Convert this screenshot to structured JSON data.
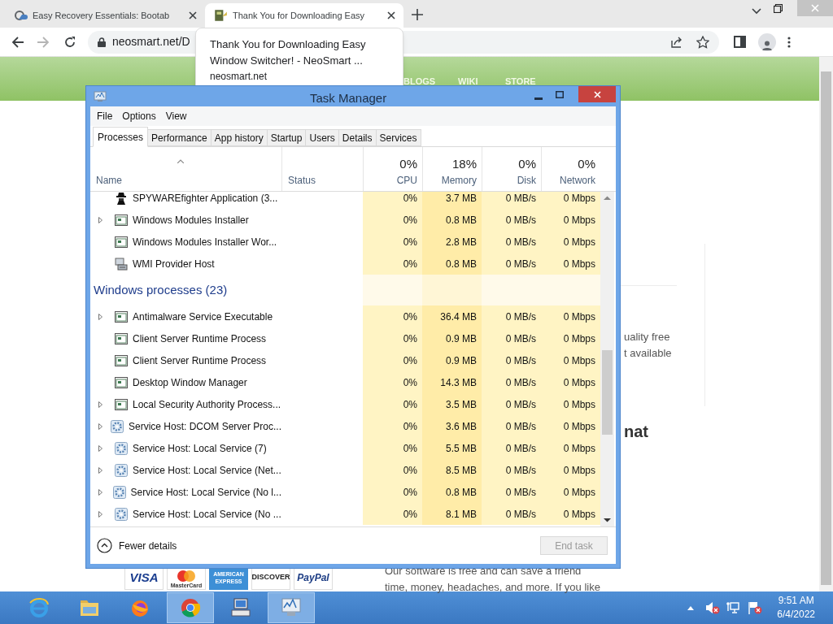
{
  "browser": {
    "tabs": [
      {
        "title": "Easy Recovery Essentials: Bootab",
        "selected": false
      },
      {
        "title": "Thank You for Downloading Easy",
        "selected": true
      }
    ],
    "address": "neosmart.net/D",
    "tooltip": {
      "title": "Thank You for Downloading Easy Window Switcher! - NeoSmart ...",
      "domain": "neosmart.net"
    }
  },
  "site": {
    "nav": [
      "BLOGS",
      "WIKI",
      "STORE"
    ],
    "fragments": [
      "uality free",
      "t available"
    ],
    "heading": "nat",
    "paragraph": [
      "Our software is free and can save a friend",
      "time, money, headaches, and more. If you like"
    ],
    "payment_logos": [
      {
        "kind": "visa",
        "text": "VISA"
      },
      {
        "kind": "mastercard",
        "text": "MasterCard"
      },
      {
        "kind": "amex",
        "text": "AMERICAN EXPRESS"
      },
      {
        "kind": "discover",
        "text": "DISCOVER"
      },
      {
        "kind": "paypal",
        "text": "PayPal"
      }
    ]
  },
  "task_manager": {
    "title": "Task Manager",
    "menu": [
      "File",
      "Options",
      "View"
    ],
    "tabs": [
      {
        "label": "Processes",
        "selected": true
      },
      {
        "label": "Performance",
        "selected": false
      },
      {
        "label": "App history",
        "selected": false
      },
      {
        "label": "Startup",
        "selected": false
      },
      {
        "label": "Users",
        "selected": false
      },
      {
        "label": "Details",
        "selected": false
      },
      {
        "label": "Services",
        "selected": false
      }
    ],
    "columns": [
      {
        "label": "Name"
      },
      {
        "label": "Status"
      },
      {
        "label": "CPU",
        "percent": "0%"
      },
      {
        "label": "Memory",
        "percent": "18%"
      },
      {
        "label": "Disk",
        "percent": "0%"
      },
      {
        "label": "Network",
        "percent": "0%"
      }
    ],
    "rows": [
      {
        "kind": "figure",
        "name": "SPYWAREfighter Application (3...",
        "expandable": false,
        "cpu": "0%",
        "memory": "3.7 MB",
        "disk": "0 MB/s",
        "network": "0 Mbps"
      },
      {
        "kind": "app",
        "name": "Windows Modules Installer",
        "expandable": true,
        "cpu": "0%",
        "memory": "0.8 MB",
        "disk": "0 MB/s",
        "network": "0 Mbps"
      },
      {
        "kind": "app",
        "name": "Windows Modules Installer Wor...",
        "expandable": false,
        "cpu": "0%",
        "memory": "2.8 MB",
        "disk": "0 MB/s",
        "network": "0 Mbps"
      },
      {
        "kind": "machine",
        "name": "WMI Provider Host",
        "expandable": false,
        "cpu": "0%",
        "memory": "0.8 MB",
        "disk": "0 MB/s",
        "network": "0 Mbps"
      },
      {
        "kind": "group",
        "name": "Windows processes (23)"
      },
      {
        "kind": "app",
        "name": "Antimalware Service Executable",
        "expandable": true,
        "cpu": "0%",
        "memory": "36.4 MB",
        "disk": "0 MB/s",
        "network": "0 Mbps"
      },
      {
        "kind": "app",
        "name": "Client Server Runtime Process",
        "expandable": false,
        "cpu": "0%",
        "memory": "0.9 MB",
        "disk": "0 MB/s",
        "network": "0 Mbps"
      },
      {
        "kind": "app",
        "name": "Client Server Runtime Process",
        "expandable": false,
        "cpu": "0%",
        "memory": "0.9 MB",
        "disk": "0 MB/s",
        "network": "0 Mbps"
      },
      {
        "kind": "app",
        "name": "Desktop Window Manager",
        "expandable": false,
        "cpu": "0%",
        "memory": "14.3 MB",
        "disk": "0 MB/s",
        "network": "0 Mbps"
      },
      {
        "kind": "app",
        "name": "Local Security Authority Process...",
        "expandable": true,
        "cpu": "0%",
        "memory": "3.5 MB",
        "disk": "0 MB/s",
        "network": "0 Mbps"
      },
      {
        "kind": "gear",
        "name": "Service Host: DCOM Server Proc...",
        "expandable": true,
        "cpu": "0%",
        "memory": "3.6 MB",
        "disk": "0 MB/s",
        "network": "0 Mbps"
      },
      {
        "kind": "gear",
        "name": "Service Host: Local Service (7)",
        "expandable": true,
        "cpu": "0%",
        "memory": "5.5 MB",
        "disk": "0 MB/s",
        "network": "0 Mbps"
      },
      {
        "kind": "gear",
        "name": "Service Host: Local Service (Net...",
        "expandable": true,
        "cpu": "0%",
        "memory": "8.5 MB",
        "disk": "0 MB/s",
        "network": "0 Mbps"
      },
      {
        "kind": "gear",
        "name": "Service Host: Local Service (No l...",
        "expandable": true,
        "cpu": "0%",
        "memory": "0.8 MB",
        "disk": "0 MB/s",
        "network": "0 Mbps"
      },
      {
        "kind": "gear",
        "name": "Service Host: Local Service (No ...",
        "expandable": true,
        "cpu": "0%",
        "memory": "8.1 MB",
        "disk": "0 MB/s",
        "network": "0 Mbps"
      }
    ],
    "fewer_details": "Fewer details",
    "end_task": {
      "label": "End task",
      "disabled": true
    }
  },
  "taskbar": {
    "apps": [
      {
        "kind": "ie",
        "active": false
      },
      {
        "kind": "explorer",
        "active": false
      },
      {
        "kind": "firefox",
        "active": false
      },
      {
        "kind": "chrome",
        "active": true
      },
      {
        "kind": "computer",
        "active": false
      },
      {
        "kind": "taskmgr",
        "active": true
      }
    ],
    "time": "9:51 AM",
    "date": "6/4/2022"
  }
}
